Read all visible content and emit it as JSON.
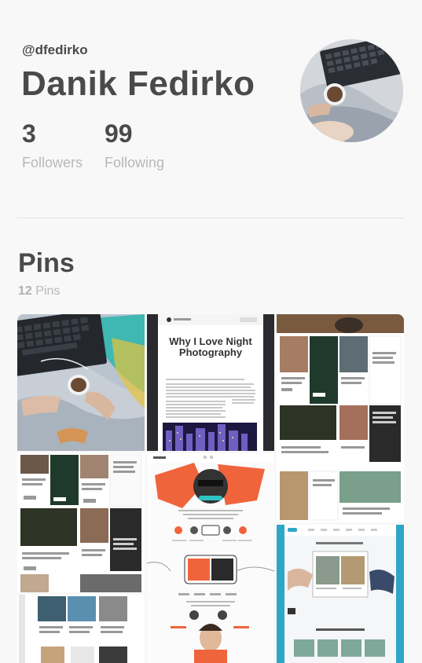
{
  "profile": {
    "handle": "@dfedirko",
    "name": "Danik Fedirko",
    "followers_count": "3",
    "followers_label": "Followers",
    "following_count": "99",
    "following_label": "Following"
  },
  "pins": {
    "title": "Pins",
    "count": "12",
    "count_label": " Pins",
    "items": [
      {
        "name": "laptop-coffee-photo"
      },
      {
        "name": "night-photography-article",
        "headline": "Why I Love Night Photography"
      },
      {
        "name": "blog-grid-template"
      },
      {
        "name": "blog-grid-template-dark"
      },
      {
        "name": "hacker-landing-page"
      },
      {
        "name": "photo-book-mockup"
      },
      {
        "name": "travel-blog-grid"
      }
    ]
  },
  "colors": {
    "background": "#f8f8f8",
    "text": "#4a4a4a",
    "muted": "#b8b8b8",
    "accent_teal": "#2ec4c4",
    "accent_orange": "#f0643c"
  }
}
